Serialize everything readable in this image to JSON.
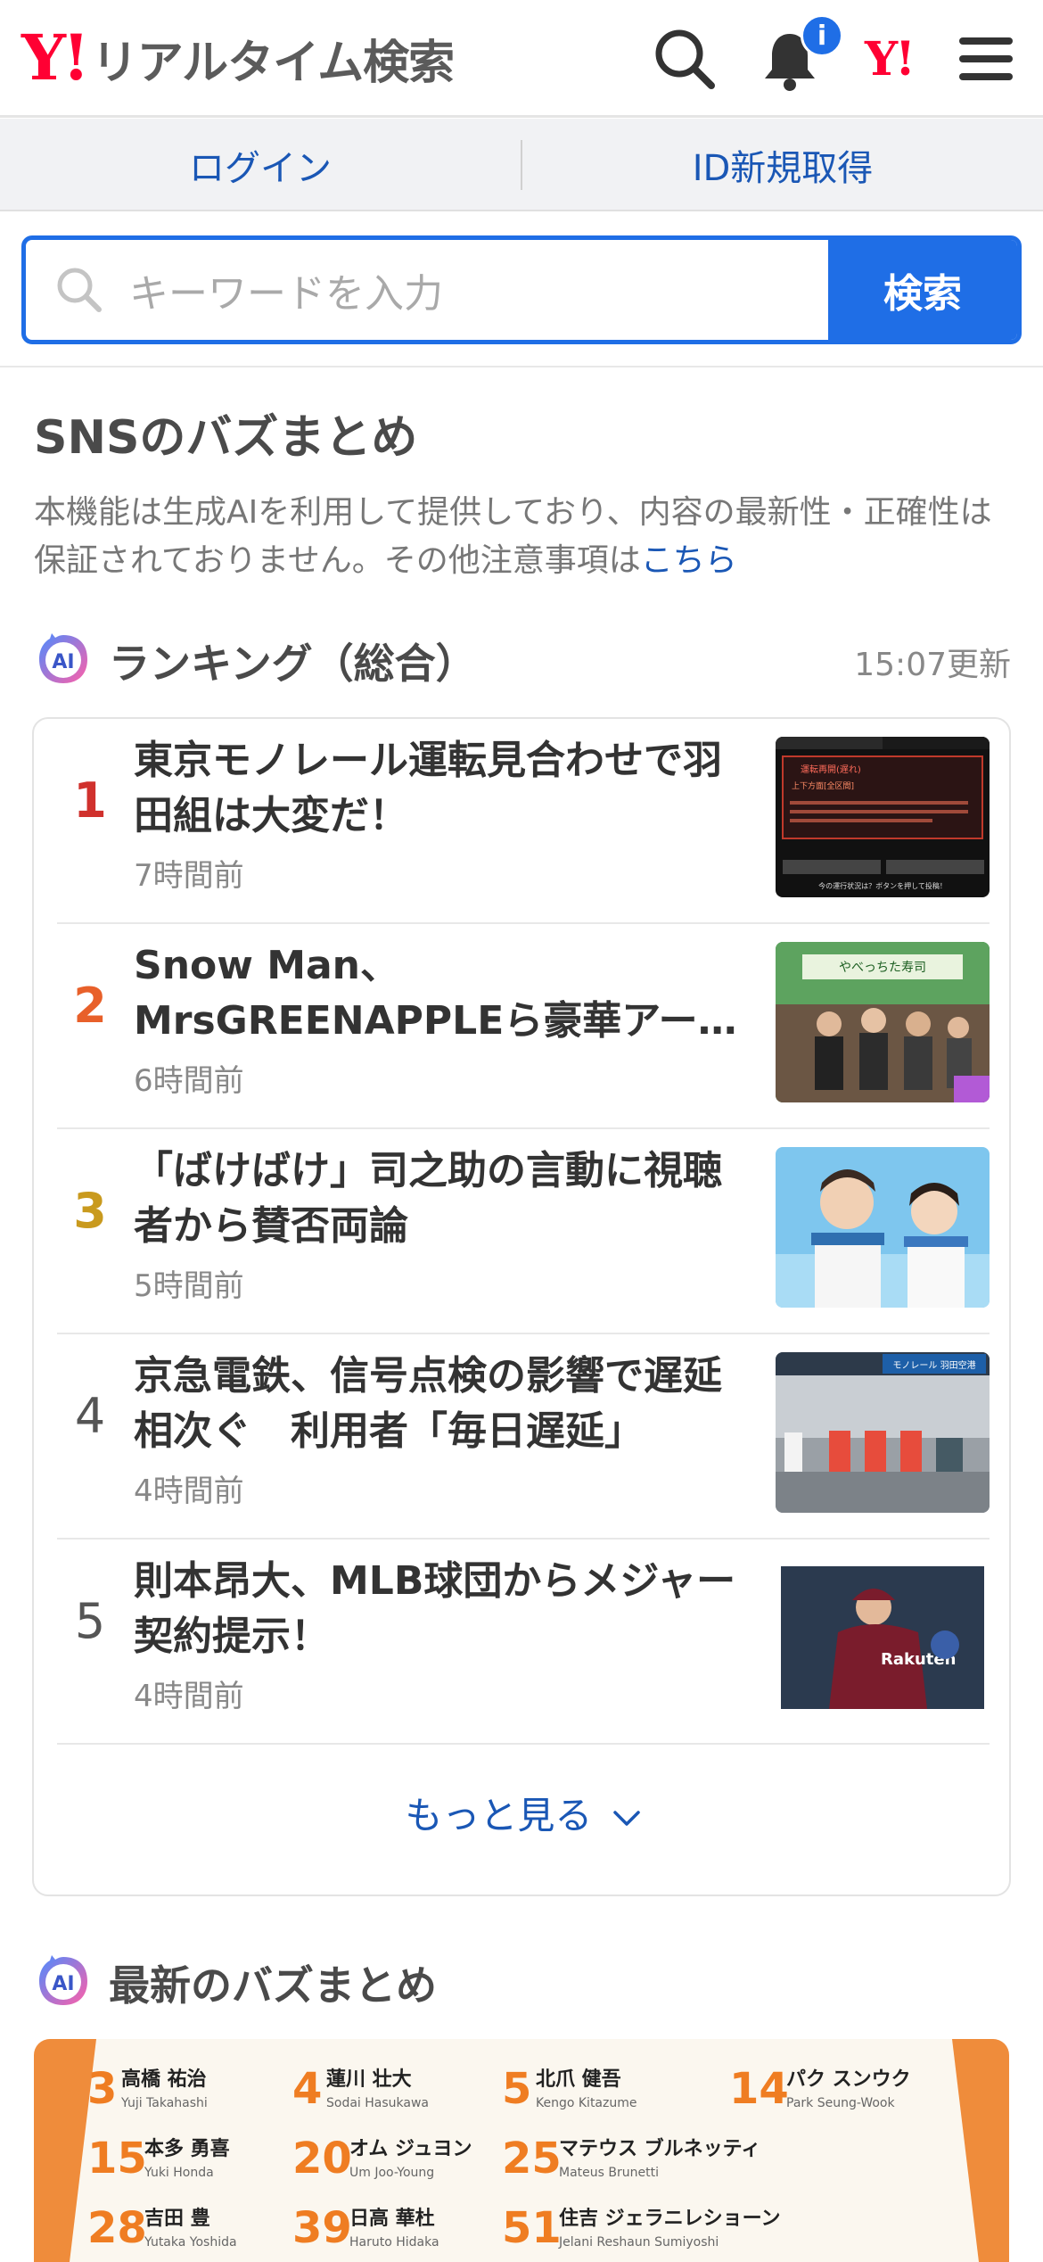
{
  "header": {
    "logo_mark": "Y!",
    "logo_text": "リアルタイム検索",
    "notification_badge": "i",
    "yahoo_mark": "Y!"
  },
  "auth": {
    "login": "ログイン",
    "signup": "ID新規取得"
  },
  "search": {
    "placeholder": "キーワードを入力",
    "button": "検索"
  },
  "buzz_summary": {
    "title": "SNSのバズまとめ",
    "disclaimer": "本機能は生成AIを利用して提供しており、内容の最新性・正確性は保証されておりません。その他注意事項は",
    "disclaimer_link": "こちら"
  },
  "ranking": {
    "ai_badge": "AI",
    "title": "ランキング（総合）",
    "updated": "15:07更新",
    "items": [
      {
        "rank": "1",
        "title": "東京モノレール運転見合わせで羽田組は大変だ！",
        "time": "7時間前",
        "rank_color": "#d0312d"
      },
      {
        "rank": "2",
        "title": "Snow Man、MrsGREENAPPLEら豪華アー…",
        "time": "6時間前",
        "rank_color": "#e8602a"
      },
      {
        "rank": "3",
        "title": "「ばけばけ」司之助の言動に視聴者から賛否両論",
        "time": "5時間前",
        "rank_color": "#c99a1e"
      },
      {
        "rank": "4",
        "title": "京急電鉄、信号点検の影響で遅延相次ぐ　利用者「毎日遅延」",
        "time": "4時間前",
        "rank_color": "#555555"
      },
      {
        "rank": "5",
        "title": "則本昂大、MLB球団からメジャー契約提示！",
        "time": "4時間前",
        "rank_color": "#555555"
      }
    ],
    "more": "もっと見る"
  },
  "latest": {
    "ai_badge": "AI",
    "title": "最新のバズまとめ",
    "roster": [
      {
        "no": "3",
        "name": "高橋 祐治",
        "roman": "Yuji Takahashi"
      },
      {
        "no": "4",
        "name": "蓮川 壮大",
        "roman": "Sodai Hasukawa"
      },
      {
        "no": "5",
        "name": "北爪 健吾",
        "roman": "Kengo Kitazume"
      },
      {
        "no": "14",
        "name": "パク スンウク",
        "roman": "Park Seung-Wook"
      },
      {
        "no": "15",
        "name": "本多 勇喜",
        "roman": "Yuki Honda"
      },
      {
        "no": "20",
        "name": "オム ジュヨン",
        "roman": "Um Joo-Young"
      },
      {
        "no": "25",
        "name": "マテウス ブルネッティ",
        "roman": "Mateus Brunetti"
      },
      {
        "no": "28",
        "name": "吉田 豊",
        "roman": "Yutaka Yoshida"
      },
      {
        "no": "39",
        "name": "日高 華杜",
        "roman": "Haruto Hidaka"
      },
      {
        "no": "51",
        "name": "住吉 ジェラニレショーン",
        "roman": "Jelani Reshaun Sumiyoshi"
      }
    ]
  },
  "thumbnail_text": {
    "t1_alert": "運転再開(遅れ)",
    "t1_line": "上下方面[全区間]",
    "t1_btn": "今の運行状況は？ボタンを押して投稿！",
    "t2_sign": "やべっちた寿司",
    "t4_sign": "モノレール 羽田空港",
    "t5_jersey": "Rakuten"
  },
  "colors": {
    "accent": "#1f6ee6",
    "link": "#1a57b5",
    "brand_red": "#ff0033"
  }
}
